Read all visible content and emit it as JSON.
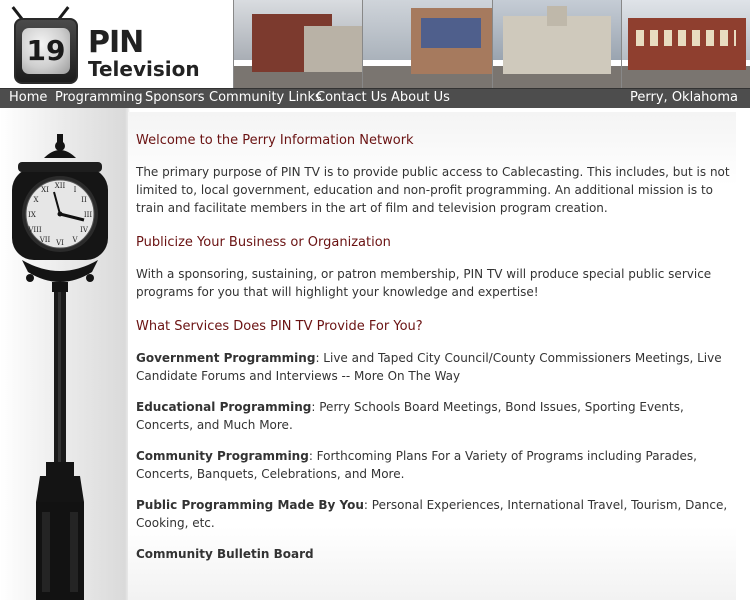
{
  "logo": {
    "channel_number": "19",
    "brand_line1": "PIN",
    "brand_line2": "Television"
  },
  "nav": {
    "items": [
      "Home",
      "Programming",
      "Sponsors",
      "Community Links",
      "Contact Us",
      "About Us"
    ],
    "location": "Perry, Oklahoma"
  },
  "sections": {
    "welcome": {
      "heading": "Welcome to the Perry Information Network",
      "text": "The primary purpose of PIN TV is to provide public access to Cablecasting.  This includes, but is not limited to, local government, education and non-profit programming.  An additional mission is to train and facilitate members in the art of film and television program creation."
    },
    "publicize": {
      "heading": "Publicize Your Business or Organization",
      "text": "With a sponsoring, sustaining, or patron membership, PIN TV will produce special public service programs for you that will highlight your knowledge and expertise!"
    },
    "services": {
      "heading": "What Services Does PIN TV Provide For You?",
      "items": [
        {
          "label": "Government Programming",
          "text": ": Live and Taped City Council/County Commissioners Meetings, Live Candidate Forums and Interviews -- More On The Way"
        },
        {
          "label": "Educational Programming",
          "text": ": Perry Schools Board Meetings, Bond Issues, Sporting Events, Concerts, and Much More."
        },
        {
          "label": "Community Programming",
          "text": ": Forthcoming Plans For a Variety of Programs including Parades, Concerts, Banquets, Celebrations, and More."
        },
        {
          "label": "Public Programming Made By You",
          "text": ": Personal Experiences, International Travel, Tourism, Dance, Cooking, etc."
        }
      ],
      "bulletin": "Community Bulletin Board"
    }
  },
  "colors": {
    "nav_bg": "#4d4d4d",
    "heading": "#6a1212",
    "text": "#333333"
  }
}
